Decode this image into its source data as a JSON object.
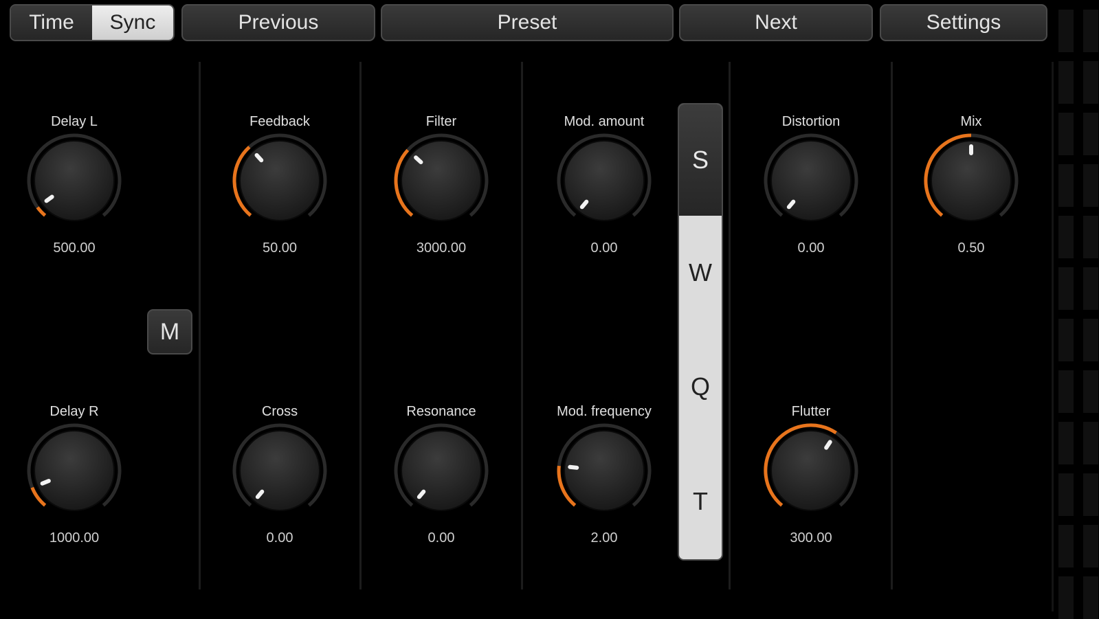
{
  "toolbar": {
    "mode_time": "Time",
    "mode_sync": "Sync",
    "previous": "Previous",
    "preset": "Preset",
    "next": "Next",
    "settings": "Settings"
  },
  "knobs": {
    "delay_l": {
      "label": "Delay L",
      "value": "500.00",
      "level": 0.05
    },
    "delay_r": {
      "label": "Delay R",
      "value": "1000.00",
      "level": 0.1
    },
    "feedback": {
      "label": "Feedback",
      "value": "50.00",
      "level": 0.35
    },
    "cross": {
      "label": "Cross",
      "value": "0.00",
      "level": 0.0
    },
    "filter": {
      "label": "Filter",
      "value": "3000.00",
      "level": 0.33
    },
    "resonance": {
      "label": "Resonance",
      "value": "0.00",
      "level": 0.0
    },
    "mod_amount": {
      "label": "Mod. amount",
      "value": "0.00",
      "level": 0.0
    },
    "mod_freq": {
      "label": "Mod. frequency",
      "value": "2.00",
      "level": 0.2
    },
    "distortion": {
      "label": "Distortion",
      "value": "0.00",
      "level": 0.0
    },
    "flutter": {
      "label": "Flutter",
      "value": "300.00",
      "level": 0.62
    },
    "mix": {
      "label": "Mix",
      "value": "0.50",
      "level": 0.5
    }
  },
  "m_button": "M",
  "selector": {
    "options": [
      "S",
      "W",
      "Q",
      "T"
    ],
    "selected": "S"
  },
  "colors": {
    "accent": "#e8741c",
    "background": "#000000"
  }
}
